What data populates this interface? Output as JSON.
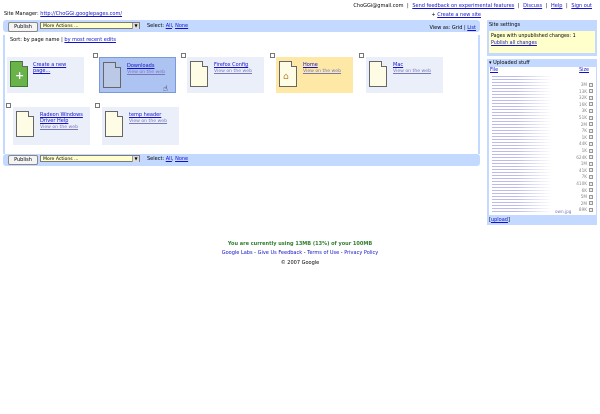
{
  "top": {
    "user_email": "ChoGGi@gmail.com",
    "links": [
      "Send feedback on experimental features",
      "Discuss",
      "Help",
      "Sign out"
    ],
    "site_manager_label": "Site Manager:",
    "site_url": "http://ChoGGi.googlepages.com/",
    "create_site_link": "Create a new site",
    "create_site_plus": "+"
  },
  "toolbar": {
    "publish_label": "Publish",
    "more_actions": "More Actions ...",
    "select_label": "Select:",
    "select_all": "All",
    "select_none": "None",
    "view_as_label": "View as:",
    "view_grid": "Grid",
    "view_list": "List"
  },
  "sort": {
    "label": "Sort: by page name",
    "recent_link": "by most recent edits"
  },
  "tiles": [
    {
      "title": "Create a new page...",
      "kind": "new"
    },
    {
      "title": "Downloads",
      "view": "View on the web",
      "kind": "selected"
    },
    {
      "title": "Firefox Config",
      "view": "View on the web",
      "kind": "normal"
    },
    {
      "title": "Home",
      "view": "View on the web",
      "kind": "home"
    },
    {
      "title": "Mac",
      "view": "View on the web",
      "kind": "normal"
    },
    {
      "title": "Radeon Windows Driver Help",
      "view": "View on the web",
      "kind": "normal"
    },
    {
      "title": "temp header",
      "view": "View on the web",
      "kind": "normal"
    }
  ],
  "sidebar": {
    "settings_title": "Site settings",
    "unpublished_text": "Pages with unpublished changes: 1",
    "publish_all": "Publish all changes",
    "uploaded_title": "Uploaded stuff",
    "col_file": "File",
    "col_size": "Size",
    "sizes": [
      "3M",
      "13K",
      "32K",
      "16K",
      "3K",
      "51K",
      "2M",
      "7K",
      "1K",
      "44K",
      "1K",
      "624K",
      "1M",
      "41K",
      "7K",
      "410K",
      "6K",
      "5M",
      "2M",
      "89K"
    ],
    "last_file_suffix": "own.jpg",
    "upload_link": "upload",
    "upload_brackets_open": "[",
    "upload_brackets_close": "]"
  },
  "footer": {
    "usage": "You are currently using 13MB (13%) of your 100MB",
    "links": [
      "Google Labs",
      "Give Us Feedback",
      "Terms of Use",
      "Privacy Policy"
    ],
    "copyright": "© 2007 Google"
  },
  "colors": {
    "panel": "#c3d9ff",
    "link": "#1111cc",
    "usage_green": "#2e7d2e",
    "home_tile": "#fde8a5",
    "selected_tile": "#adc3f2"
  }
}
